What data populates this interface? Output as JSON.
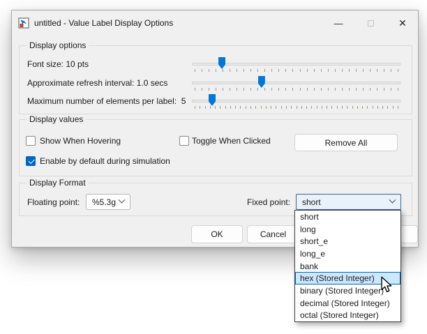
{
  "window": {
    "title": "untitled - Value Label Display Options",
    "controls": {
      "minimize": "—",
      "close": "✕"
    }
  },
  "groups": {
    "display_options": {
      "title": "Display options",
      "sliders": [
        {
          "label": "Font size: 10 pts",
          "fraction": 0.144,
          "ticks": 30
        },
        {
          "label": "Approximate refresh interval: 1.0 secs",
          "fraction": 0.334,
          "ticks": 30
        },
        {
          "label": "Maximum number of elements per label:  5",
          "fraction": 0.097,
          "ticks": 41
        }
      ]
    },
    "display_values": {
      "title": "Display values",
      "checkboxes": [
        {
          "label": "Show When Hovering",
          "checked": false
        },
        {
          "label": "Toggle When Clicked",
          "checked": false
        },
        {
          "label": "Enable by default during simulation",
          "checked": true
        }
      ],
      "remove_all_label": "Remove All"
    },
    "display_format": {
      "title": "Display Format",
      "floating_point_label": "Floating point:",
      "floating_point_value": "%5.3g",
      "fixed_point_label": "Fixed point:",
      "fixed_point_value": "short"
    }
  },
  "buttons": {
    "ok": "OK",
    "cancel": "Cancel"
  },
  "dropdown": {
    "items": [
      "short",
      "long",
      "short_e",
      "long_e",
      "bank",
      "hex (Stored Integer)",
      "binary (Stored Integer)",
      "decimal (Stored Integer)",
      "octal (Stored Integer)"
    ],
    "highlighted_index": 5
  },
  "colors": {
    "accent_blue": "#0078d7",
    "checkbox_blue": "#0067c0",
    "highlight_fill": "#cce8ff",
    "highlight_border": "#0066b4",
    "dialog_bg": "#f0f0f0"
  }
}
